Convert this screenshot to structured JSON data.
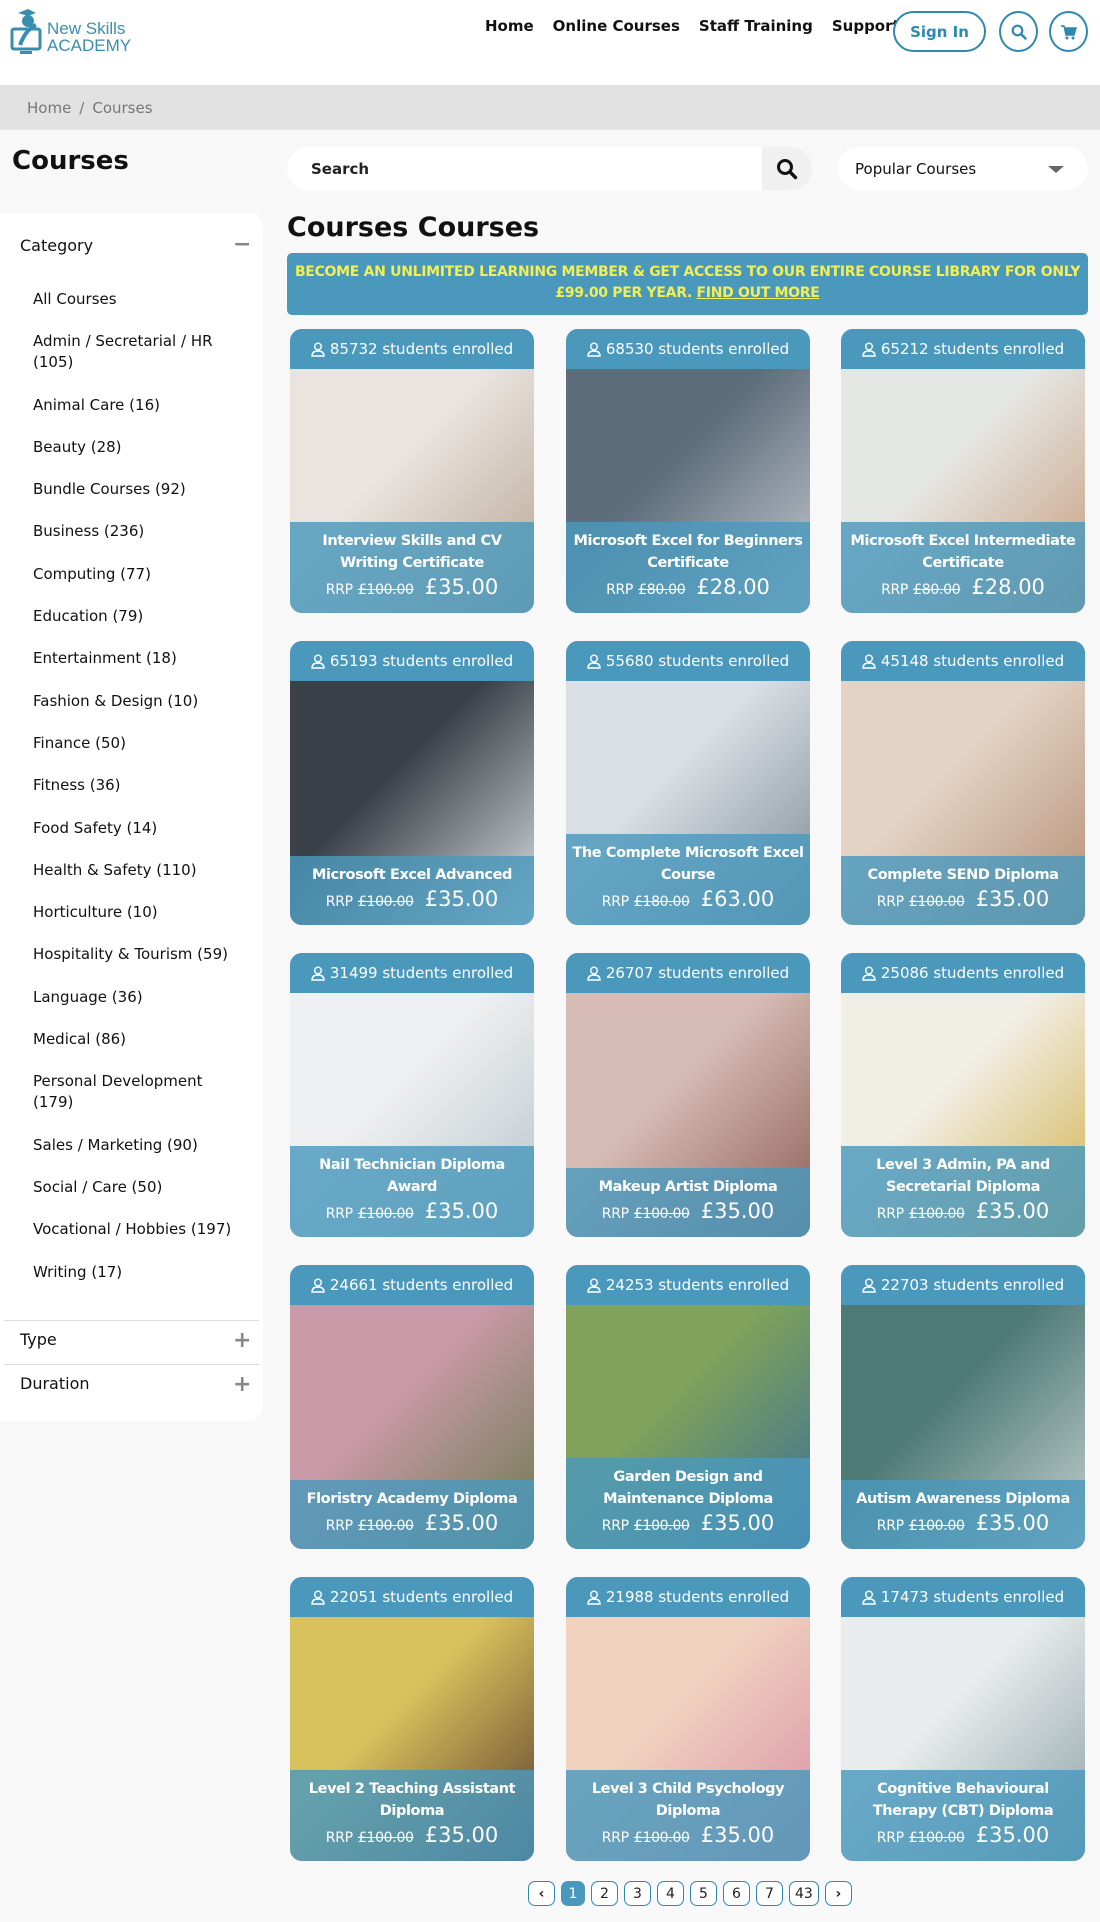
{
  "header": {
    "logo_line1": "New Skills",
    "logo_line2": "ACADEMY",
    "nav": [
      "Home",
      "Online Courses",
      "Staff Training",
      "Support"
    ],
    "sign_in": "Sign In",
    "search_icon": "search-icon",
    "cart_icon": "cart-icon"
  },
  "breadcrumb": {
    "home": "Home",
    "separator": "/",
    "current": "Courses"
  },
  "page_title": "Courses",
  "sidebar": {
    "category_label": "Category",
    "category_toggle": "−",
    "categories": [
      "All Courses",
      "Admin / Secretarial / HR (105)",
      "Animal Care (16)",
      "Beauty (28)",
      "Bundle Courses (92)",
      "Business (236)",
      "Computing (77)",
      "Education (79)",
      "Entertainment (18)",
      "Fashion & Design (10)",
      "Finance (50)",
      "Fitness (36)",
      "Food Safety (14)",
      "Health & Safety (110)",
      "Horticulture (10)",
      "Hospitality & Tourism (59)",
      "Language (36)",
      "Medical (86)",
      "Personal Development (179)",
      "Sales / Marketing (90)",
      "Social / Care (50)",
      "Vocational / Hobbies (197)",
      "Writing (17)"
    ],
    "type_label": "Type",
    "type_toggle": "+",
    "duration_label": "Duration",
    "duration_toggle": "+"
  },
  "search": {
    "placeholder": "Search",
    "value": ""
  },
  "sort": {
    "selected": "Popular Courses"
  },
  "main": {
    "heading": "Courses Courses",
    "banner_text": "BECOME AN UNLIMITED LEARNING MEMBER & GET ACCESS TO OUR ENTIRE COURSE LIBRARY FOR ONLY £99.00 PER YEAR.",
    "banner_link": "FIND OUT MORE",
    "banner_color": "#4b98bd",
    "banner_text_color": "#f2ef54"
  },
  "courses": [
    {
      "enrolled": "85732 students enrolled",
      "title": "Interview Skills and CV Writing Certificate",
      "rrp_label": "RRP",
      "rrp": "£100.00",
      "price": "£35.00"
    },
    {
      "enrolled": "68530 students enrolled",
      "title": "Microsoft Excel for Beginners Certificate",
      "rrp_label": "RRP",
      "rrp": "£80.00",
      "price": "£28.00"
    },
    {
      "enrolled": "65212 students enrolled",
      "title": "Microsoft Excel Intermediate Certificate",
      "rrp_label": "RRP",
      "rrp": "£80.00",
      "price": "£28.00"
    },
    {
      "enrolled": "65193 students enrolled",
      "title": "Microsoft Excel Advanced",
      "rrp_label": "RRP",
      "rrp": "£100.00",
      "price": "£35.00"
    },
    {
      "enrolled": "55680 students enrolled",
      "title": "The Complete Microsoft Excel Course",
      "rrp_label": "RRP",
      "rrp": "£180.00",
      "price": "£63.00"
    },
    {
      "enrolled": "45148 students enrolled",
      "title": "Complete SEND Diploma",
      "rrp_label": "RRP",
      "rrp": "£100.00",
      "price": "£35.00"
    },
    {
      "enrolled": "31499 students enrolled",
      "title": "Nail Technician Diploma Award",
      "rrp_label": "RRP",
      "rrp": "£100.00",
      "price": "£35.00"
    },
    {
      "enrolled": "26707 students enrolled",
      "title": "Makeup Artist Diploma",
      "rrp_label": "RRP",
      "rrp": "£100.00",
      "price": "£35.00"
    },
    {
      "enrolled": "25086 students enrolled",
      "title": "Level 3 Admin, PA and Secretarial Diploma",
      "rrp_label": "RRP",
      "rrp": "£100.00",
      "price": "£35.00"
    },
    {
      "enrolled": "24661 students enrolled",
      "title": "Floristry Academy Diploma",
      "rrp_label": "RRP",
      "rrp": "£100.00",
      "price": "£35.00"
    },
    {
      "enrolled": "24253 students enrolled",
      "title": "Garden Design and Maintenance Diploma",
      "rrp_label": "RRP",
      "rrp": "£100.00",
      "price": "£35.00"
    },
    {
      "enrolled": "22703 students enrolled",
      "title": "Autism Awareness Diploma",
      "rrp_label": "RRP",
      "rrp": "£100.00",
      "price": "£35.00"
    },
    {
      "enrolled": "22051 students enrolled",
      "title": "Level 2 Teaching Assistant Diploma",
      "rrp_label": "RRP",
      "rrp": "£100.00",
      "price": "£35.00"
    },
    {
      "enrolled": "21988 students enrolled",
      "title": "Level 3 Child Psychology Diploma",
      "rrp_label": "RRP",
      "rrp": "£100.00",
      "price": "£35.00"
    },
    {
      "enrolled": "17473 students enrolled",
      "title": "Cognitive Behavioural Therapy (CBT) Diploma",
      "rrp_label": "RRP",
      "rrp": "£100.00",
      "price": "£35.00"
    }
  ],
  "course_image_tints": [
    [
      "#e9e4df",
      "#b7a593"
    ],
    [
      "#5d6d7b",
      "#c8ccd2"
    ],
    [
      "#e5e7e4",
      "#c79a78"
    ],
    [
      "#3b4148",
      "#dde2e6"
    ],
    [
      "#d9dfe4",
      "#7c8a95"
    ],
    [
      "#e3d3c4",
      "#b48e74"
    ],
    [
      "#eef0f1",
      "#b9c3ca"
    ],
    [
      "#d7bcb5",
      "#8b5e57"
    ],
    [
      "#f1eee6",
      "#d3b24d"
    ],
    [
      "#c99aa8",
      "#6b7a4e"
    ],
    [
      "#7fa35a",
      "#3d6e97"
    ],
    [
      "#4e7a76",
      "#c5d1cf"
    ],
    [
      "#d8c25d",
      "#5a3d2c"
    ],
    [
      "#f0d2bf",
      "#d88fa4"
    ],
    [
      "#e9ecec",
      "#8aa0a6"
    ]
  ],
  "pagination": {
    "prev": "‹",
    "pages": [
      "1",
      "2",
      "3",
      "4",
      "5",
      "6",
      "7",
      "43"
    ],
    "current": "1",
    "next": "›"
  }
}
